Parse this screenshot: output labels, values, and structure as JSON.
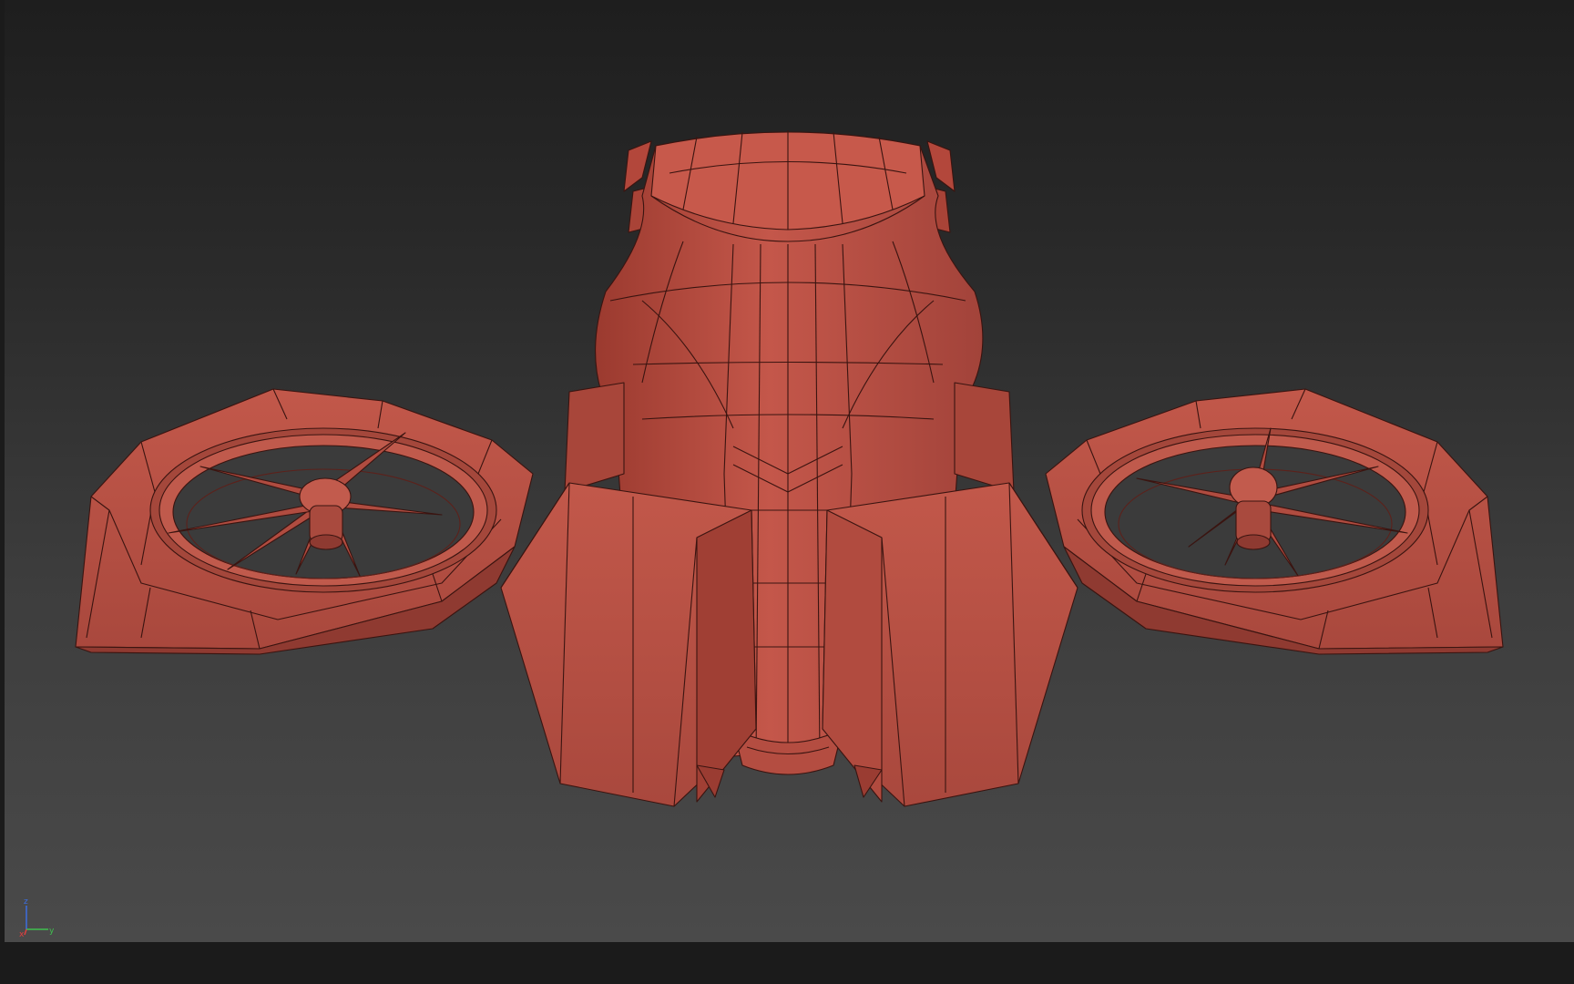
{
  "viewport": {
    "name": "3D viewport",
    "render_mode": "wireframe-on-shaded",
    "background": "#2b2b2b",
    "model_color": "#b04a3d",
    "edge_color": "#3a1410"
  },
  "gizmo": {
    "z": "z",
    "x": "x",
    "y": "y"
  }
}
